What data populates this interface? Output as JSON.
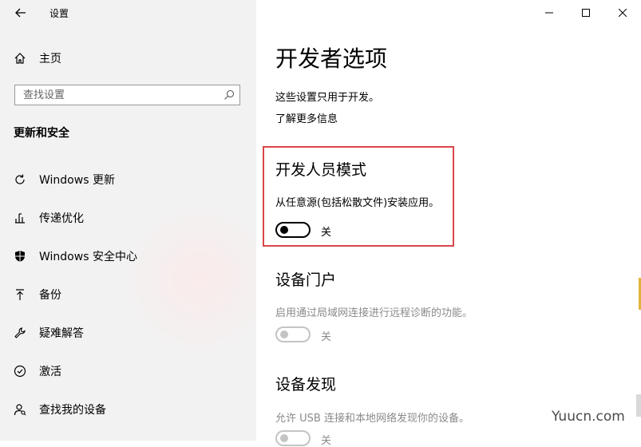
{
  "window": {
    "title": "设置",
    "minimize": "minimize",
    "maximize": "maximize",
    "close": "close"
  },
  "sidebar": {
    "home_label": "主页",
    "search_placeholder": "查找设置",
    "section_title": "更新和安全",
    "items": [
      {
        "label": "Windows 更新",
        "icon": "refresh-icon"
      },
      {
        "label": "传递优化",
        "icon": "delivery-optimization-icon"
      },
      {
        "label": "Windows 安全中心",
        "icon": "shield-icon"
      },
      {
        "label": "备份",
        "icon": "backup-arrow-icon"
      },
      {
        "label": "疑难解答",
        "icon": "wrench-icon"
      },
      {
        "label": "激活",
        "icon": "check-circle-icon"
      },
      {
        "label": "查找我的设备",
        "icon": "person-locate-icon"
      }
    ]
  },
  "main": {
    "page_title": "开发者选项",
    "description": "这些设置只用于开发。",
    "learn_more": "了解更多信息",
    "groups": [
      {
        "title": "开发人员模式",
        "description": "从任意源(包括松散文件)安装应用。",
        "toggle_state": "关",
        "enabled": true,
        "highlighted": true
      },
      {
        "title": "设备门户",
        "description": "启用通过局域网连接进行远程诊断的功能。",
        "toggle_state": "关",
        "enabled": false
      },
      {
        "title": "设备发现",
        "description": "允许 USB 连接和本地网络发现你的设备。",
        "toggle_state": "关",
        "enabled": false
      }
    ]
  },
  "watermark": "Yuucn.com",
  "colors": {
    "sidebar_bg": "#f2f2f2",
    "highlight_border": "#d9464a",
    "disabled_text": "#8a8a8a",
    "accent": "#e2b33a"
  }
}
